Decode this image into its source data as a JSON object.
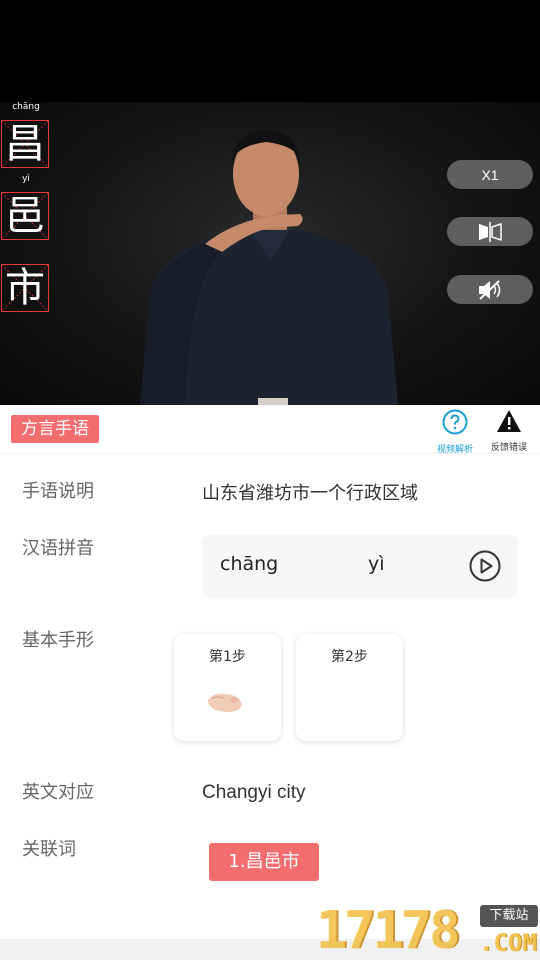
{
  "video": {
    "characters": [
      {
        "char": "昌",
        "pinyin": "chāng"
      },
      {
        "char": "邑",
        "pinyin": "yì"
      },
      {
        "char": "市",
        "pinyin": ""
      }
    ],
    "controls": {
      "speed_label": "X1",
      "mirror_icon": "mirror-flip-icon",
      "mute_icon": "speaker-muted-icon"
    }
  },
  "panel": {
    "dialect_tag": "方言手语",
    "tools": [
      {
        "label": "视频解析",
        "icon": "question-circle-icon",
        "color": "#1ba0d4"
      },
      {
        "label": "反馈错误",
        "icon": "warning-triangle-icon",
        "color": "#111111"
      }
    ],
    "description": {
      "label": "手语说明",
      "value": "山东省潍坊市一个行政区域"
    },
    "pinyin": {
      "label": "汉语拼音",
      "syllables": [
        "chāng",
        "yì"
      ],
      "play_icon": "play-circle-icon"
    },
    "handshape": {
      "label": "基本手形",
      "steps": [
        "第1步",
        "第2步"
      ]
    },
    "english": {
      "label": "英文对应",
      "value": "Changyi city"
    },
    "related": {
      "label": "关联词",
      "items": [
        "1.昌邑市"
      ]
    }
  },
  "watermark": {
    "digits": "17178",
    "badge": "下载站",
    "suffix": ".COM"
  },
  "colors": {
    "accent": "#f26d6d",
    "info_blue": "#1ba0d4",
    "box_red": "#e53935"
  }
}
